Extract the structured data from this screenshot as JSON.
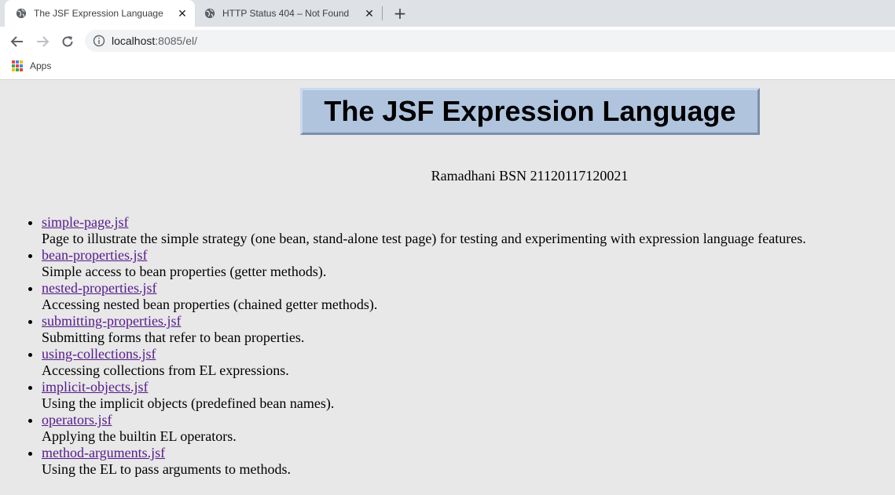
{
  "browser": {
    "tabs": [
      {
        "title": "The JSF Expression Language",
        "active": true
      },
      {
        "title": "HTTP Status 404 – Not Found",
        "active": false
      }
    ],
    "url_host": "localhost",
    "url_rest": ":8085/el/",
    "bookmarks": {
      "apps_label": "Apps"
    }
  },
  "page": {
    "heading": "The JSF Expression Language",
    "author": "Ramadhani BSN 21120117120021",
    "links": [
      {
        "label": "simple-page.jsf",
        "desc": "Page to illustrate the simple strategy (one bean, stand-alone test page) for testing and experimenting with expression language features."
      },
      {
        "label": "bean-properties.jsf",
        "desc": "Simple access to bean properties (getter methods)."
      },
      {
        "label": "nested-properties.jsf",
        "desc": "Accessing nested bean properties (chained getter methods)."
      },
      {
        "label": "submitting-properties.jsf",
        "desc": "Submitting forms that refer to bean properties."
      },
      {
        "label": "using-collections.jsf",
        "desc": "Accessing collections from EL expressions."
      },
      {
        "label": "implicit-objects.jsf",
        "desc": "Using the implicit objects (predefined bean names)."
      },
      {
        "label": "operators.jsf",
        "desc": "Applying the builtin EL operators."
      },
      {
        "label": "method-arguments.jsf",
        "desc": "Using the EL to pass arguments to methods."
      }
    ]
  },
  "colors": {
    "link": "#551a8b",
    "heading_bg": "#b0c4de",
    "page_bg": "#e8e8e8"
  }
}
